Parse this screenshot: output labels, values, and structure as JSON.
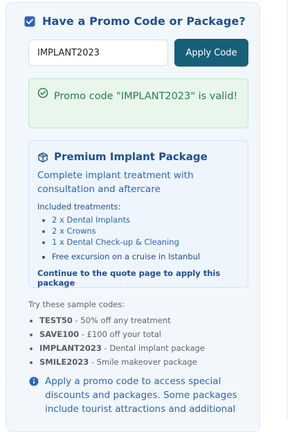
{
  "header": {
    "title": "Have a Promo Code or Package?",
    "icon": "ticket-icon"
  },
  "promo": {
    "input_value": "IMPLANT2023",
    "apply_label": "Apply Code",
    "valid_message": "Promo code \"IMPLANT2023\" is valid!"
  },
  "package": {
    "title": "Premium Implant Package",
    "description": "Complete implant treatment with consultation and aftercare",
    "included_label": "Included treatments:",
    "items": [
      "2 x Dental Implants",
      "2 x Crowns",
      "1 x Dental Check-up & Cleaning"
    ],
    "excursion": "Free excursion on a cruise in Istanbul",
    "continue_text": "Continue to the quote page to apply this package"
  },
  "samples": {
    "label": "Try these sample codes:",
    "codes": [
      {
        "code": "TEST50",
        "desc": " - 50% off any treatment"
      },
      {
        "code": "SAVE100",
        "desc": " - £100 off your total"
      },
      {
        "code": "IMPLANT2023",
        "desc": " - Dental implant package"
      },
      {
        "code": "SMILE2023",
        "desc": " - Smile makeover package"
      }
    ]
  },
  "info": {
    "text": "Apply a promo code to access special discounts and packages. Some packages include tourist attractions and additional"
  },
  "colors": {
    "primary": "#1f4e96",
    "button": "#17607a",
    "success": "#2b7d47",
    "success_bg": "#e8f6ec",
    "panel_bg": "#f2f7fb"
  }
}
